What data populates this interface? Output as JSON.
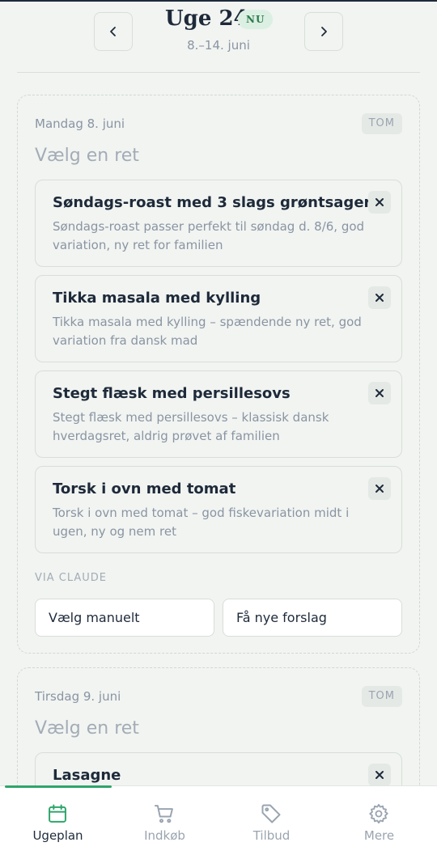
{
  "header": {
    "week_title": "Uge 24",
    "now_badge": "NU",
    "week_range": "8.–14. juni"
  },
  "days": [
    {
      "date": "Mandag 8. juni",
      "status": "TOM",
      "choose_title": "Vælg en ret",
      "suggestions": [
        {
          "name": "Søndags-roast med 3 slags grøntsager",
          "reason": "Søndags-roast passer perfekt til søndag d. 8/6, god variation, ny ret for familien"
        },
        {
          "name": "Tikka masala med kylling",
          "reason": "Tikka masala med kylling – spændende ny ret, god variation fra dansk mad"
        },
        {
          "name": "Stegt flæsk med persillesovs",
          "reason": "Stegt flæsk med persillesovs – klassisk dansk hverdagsret, aldrig prøvet af familien"
        },
        {
          "name": "Torsk i ovn med tomat",
          "reason": "Torsk i ovn med tomat – god fiskevariation midt i ugen, ny og nem ret"
        }
      ],
      "via_label": "VIA CLAUDE",
      "manual_button": "Vælg manuelt",
      "new_suggestions_button": "Få nye forslag"
    },
    {
      "date": "Tirsdag 9. juni",
      "status": "TOM",
      "choose_title": "Vælg en ret",
      "suggestions": [
        {
          "name": "Lasagne"
        }
      ]
    }
  ],
  "bottom_nav": {
    "items": [
      {
        "label": "Ugeplan",
        "icon": "calendar-icon"
      },
      {
        "label": "Indkøb",
        "icon": "cart-icon"
      },
      {
        "label": "Tilbud",
        "icon": "tag-icon"
      },
      {
        "label": "Mere",
        "icon": "gear-icon"
      }
    ],
    "active_index": 0,
    "accent_color": "#2fa56b"
  }
}
